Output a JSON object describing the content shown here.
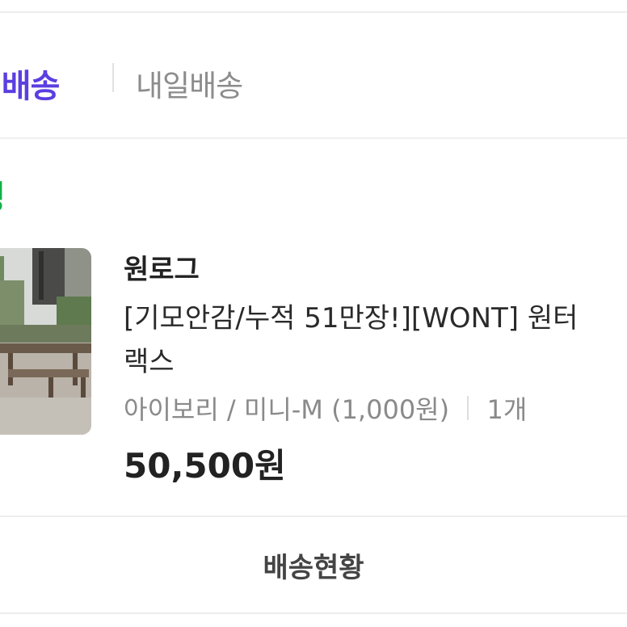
{
  "tabs": {
    "active_label": "진배송",
    "inactive_label": "내일배송"
  },
  "order": {
    "status_text": "정"
  },
  "product": {
    "brand": "원로그",
    "title_line1": "[기모안감/누적 51만장!][WONT] 원터",
    "title_line2": "랙스",
    "option": "아이보리 / 미니-M  (1,000원)",
    "quantity": "1개",
    "price": "50,500원"
  },
  "actions": {
    "delivery_status_label": "배송현황"
  },
  "colors": {
    "accent": "#5b3fe0",
    "status_green": "#12b04a"
  }
}
